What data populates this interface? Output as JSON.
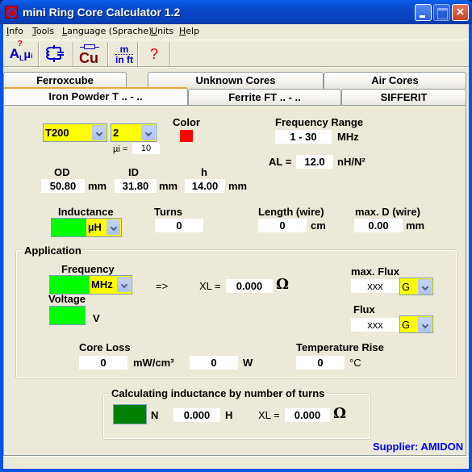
{
  "window": {
    "title": "mini Ring Core Calculator 1.2",
    "close_glyph": "×"
  },
  "menu": {
    "items": [
      {
        "label": "Info",
        "accel": "I"
      },
      {
        "label": "Tools",
        "accel": "T"
      },
      {
        "label": "Language (Sprache)",
        "accel": "L"
      },
      {
        "label": "Units",
        "accel": "U"
      },
      {
        "label": "Help",
        "accel": "H"
      }
    ]
  },
  "toolbar": {
    "al_mu_tool": {
      "main": "A",
      "sub": "L",
      "mu": "μ",
      "mu_sub": "i",
      "q": "?"
    },
    "lc_circuit_tool": "lc-circuit-icon",
    "copper_wire_tool": {
      "label": "Cu"
    },
    "units_tool": {
      "top": "m",
      "bottom": "in ft"
    },
    "help_tool": {
      "label": "?"
    }
  },
  "tabs": {
    "row_back": [
      "Ferroxcube",
      "Unknown Cores",
      "Air Cores"
    ],
    "row_front": [
      "Iron Powder T .. - ..",
      "Ferrite FT .. - ..",
      "SIFFERIT"
    ],
    "active": "Iron Powder T .. - .."
  },
  "core": {
    "size": "T200",
    "dash": "-",
    "material": "2",
    "mu_label": "µi =",
    "mu_value": "10",
    "color_label": "Color",
    "color_swatch": "#ff0000",
    "freq_range_label": "Frequency Range",
    "freq_range_value": "1 - 30",
    "freq_range_unit": "MHz",
    "al_label": "AL =",
    "al_value": "12.0",
    "al_unit": "nH/N²"
  },
  "dimensions": {
    "od_label": "OD",
    "od_value": "50.80",
    "od_unit": "mm",
    "id_label": "ID",
    "id_value": "31.80",
    "id_unit": "mm",
    "h_label": "h",
    "h_value": "14.00",
    "h_unit": "mm"
  },
  "winding": {
    "inductance_label": "Inductance",
    "inductance_unit": "µH",
    "turns_label": "Turns",
    "turns_value": "0",
    "length_label": "Length (wire)",
    "length_value": "0",
    "length_unit": "cm",
    "maxd_label": "max. D (wire)",
    "maxd_value": "0.00",
    "maxd_unit": "mm"
  },
  "application": {
    "group_title": "Application",
    "frequency_label": "Frequency",
    "frequency_unit": "MHz",
    "arrow": "=>",
    "xl_label": "XL =",
    "xl_value": "0.000",
    "ohm": "Ω",
    "voltage_label": "Voltage",
    "voltage_unit": "V",
    "max_flux_label": "max. Flux",
    "max_flux_value": "xxx",
    "max_flux_unit": "G",
    "flux_label": "Flux",
    "flux_value": "xxx",
    "flux_unit": "G",
    "core_loss_label": "Core Loss",
    "core_loss_value": "0",
    "core_loss_unit": "mW/cm³",
    "core_loss_w_value": "0",
    "core_loss_w_unit": "W",
    "temp_rise_label": "Temperature Rise",
    "temp_rise_value": "0",
    "temp_rise_unit": "°C"
  },
  "turns_calc": {
    "group_title": "Calculating inductance by number of turns",
    "n_label": "N",
    "h_value": "0.000",
    "h_unit": "H",
    "xl_label": "XL =",
    "xl_value": "0.000",
    "ohm": "Ω"
  },
  "supplier": "Supplier: AMIDON",
  "colors": {
    "input_green": "#00ff00",
    "turns_green": "#008000",
    "combo_yellow": "#ffff00",
    "supplier_blue": "#0000ff"
  }
}
